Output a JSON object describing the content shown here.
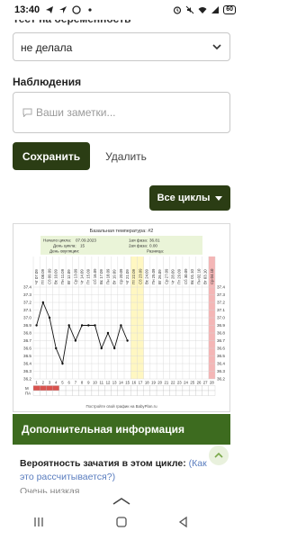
{
  "status_bar": {
    "time": "13:40",
    "battery": "60",
    "left_icons": [
      "telegram-icon",
      "location-icon",
      "whatsapp-icon",
      "dot-icon"
    ],
    "right_icons": [
      "alarm-icon",
      "mute-icon",
      "wifi-icon",
      "signal-icon"
    ]
  },
  "form": {
    "test_label_cut": "Тест на беременность",
    "test_value": "не делала",
    "observations_label": "Наблюдения",
    "observations_placeholder": "Ваши заметки...",
    "save_label": "Сохранить",
    "delete_label": "Удалить",
    "all_cycles_label": "Все циклы"
  },
  "chart": {
    "title": "Базальная температура: #2",
    "info": {
      "cycle_start_label": "Начало цикла:",
      "cycle_start_value": "07.09.2023",
      "cycle_day_label": "День цикла:",
      "cycle_day_value": "15",
      "ovulation_day_label": "День овуляции:",
      "ovulation_day_value": "",
      "phase1_label": "1ая фаза:",
      "phase1_value": "36.81",
      "phase2_label": "2ая фаза:",
      "phase2_value": "0.00",
      "difference_label": "Разница:",
      "difference_value": ""
    },
    "row_labels": [
      "М",
      "ПА"
    ],
    "footer": "Постройте свой график на BabyPlan.ru"
  },
  "chart_data": {
    "type": "line",
    "title": "Базальная температура: #2",
    "x": [
      1,
      2,
      3,
      4,
      5,
      6,
      7,
      8,
      9,
      10,
      11,
      12,
      13,
      14,
      15
    ],
    "days_total": 28,
    "dates": [
      "07.09",
      "08.09",
      "09.09",
      "10.09",
      "11.09",
      "12.09",
      "13.09",
      "14.09",
      "15.09",
      "16.09",
      "17.09",
      "18.09",
      "19.09",
      "20.09",
      "21.09",
      "22.09",
      "23.09",
      "24.09",
      "25.09",
      "26.09",
      "27.09",
      "28.09",
      "29.09",
      "30.09",
      "01.10",
      "02.10",
      "03.10",
      "04.10"
    ],
    "weekdays": [
      "Чт",
      "Пт",
      "Сб",
      "Вс",
      "Пн",
      "Вт",
      "Ср",
      "Чт",
      "Пт",
      "Сб",
      "Вс",
      "Пн",
      "Вт",
      "Ср",
      "Чт",
      "Пт",
      "Сб",
      "Вс",
      "Пн",
      "Вт",
      "Ср",
      "Чт",
      "Пт",
      "Сб",
      "Вс",
      "Пн",
      "Вт",
      "Ср"
    ],
    "series": [
      {
        "values": [
          36.9,
          37.2,
          37.0,
          36.6,
          36.4,
          36.9,
          36.7,
          36.9,
          36.9,
          36.9,
          36.6,
          36.8,
          36.6,
          36.9,
          36.7
        ]
      }
    ],
    "ylim": [
      36.2,
      37.4
    ],
    "y_ticks": [
      37.4,
      37.3,
      37.2,
      37.1,
      37.0,
      36.9,
      36.8,
      36.7,
      36.6,
      36.5,
      36.4,
      36.3,
      36.2
    ],
    "highlight_days": [
      16,
      17
    ],
    "last_day_marked": 28,
    "menstruation_days": [
      1,
      2,
      3,
      4
    ],
    "grid": true,
    "colors": {
      "line": "#111111",
      "highlight": "#fff7c2",
      "last_day": "#f4b6b6",
      "menstruation": "#d9534f",
      "grid": "#d6d6d6",
      "info_bg": "#eaf4d8"
    }
  },
  "info_section": {
    "title": "Дополнительная информация",
    "probability_label": "Вероятность зачатия в этом цикле:",
    "probability_link": "(Как это рассчитывается?)",
    "probability_value": "Очень низкая"
  },
  "colors": {
    "primary_dark": "#2b3d14",
    "info_green": "#3d6b1f"
  }
}
